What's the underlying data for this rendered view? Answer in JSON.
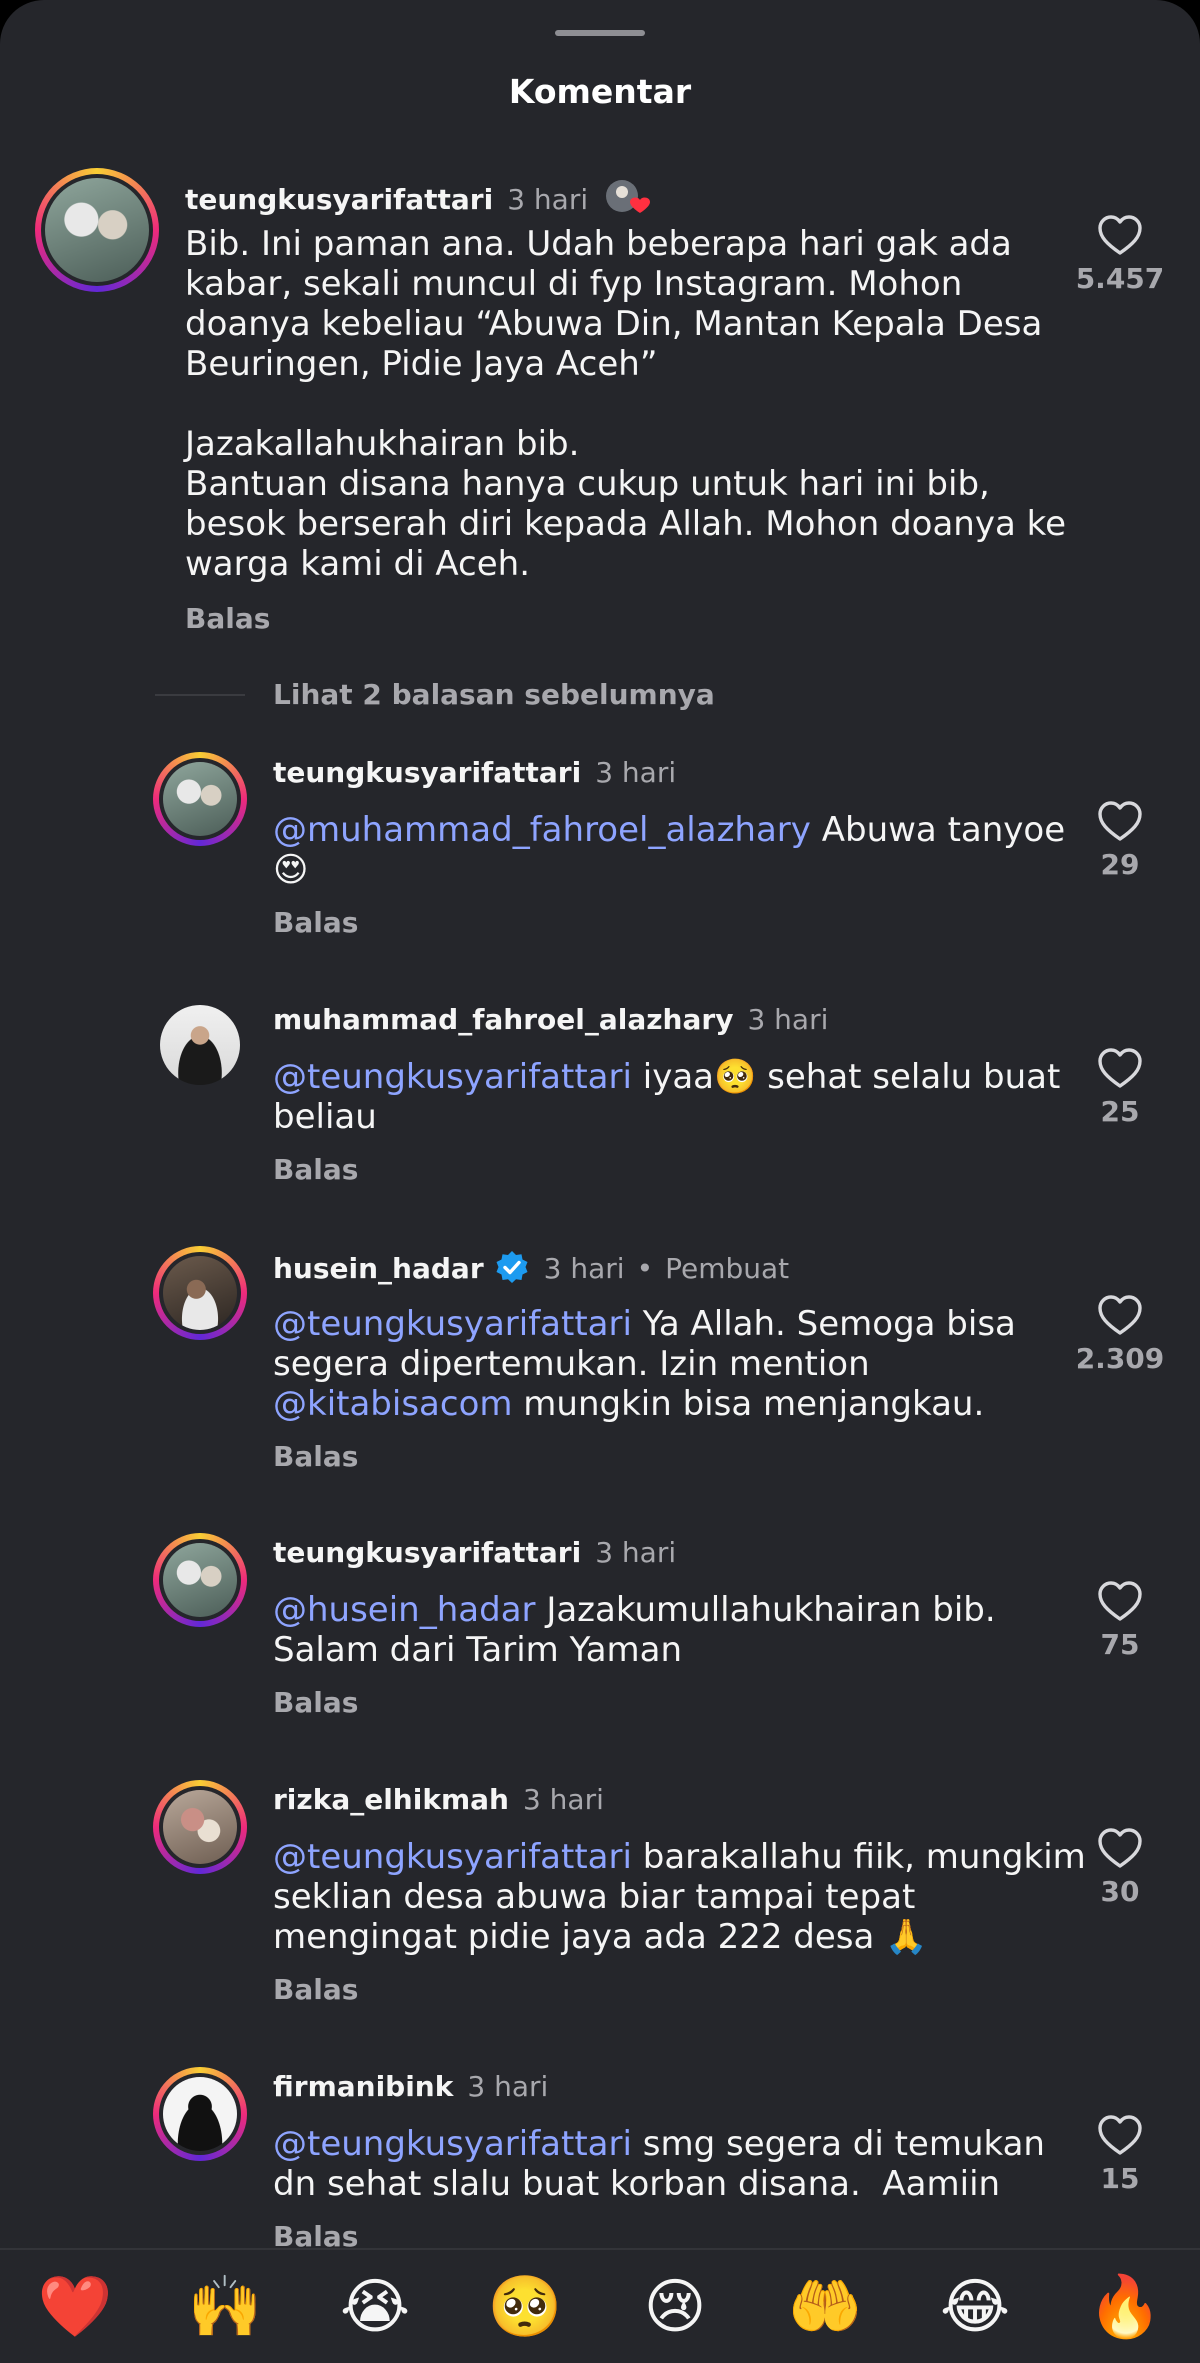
{
  "sheet": {
    "title": "Komentar"
  },
  "thread_toggle": "Lihat 2 balasan sebelumnya",
  "reply_label": "Balas",
  "comments": [
    {
      "username": "teungkusyarifattari",
      "time": "3 hari",
      "text": "Bib. Ini paman ana. Udah beberapa hari gak ada\nkabar, sekali muncul di fyp Instagram. Mohon\ndoanya kebeliau “Abuwa Din, Mantan Kepala Desa\nBeuringen, Pidie Jaya Aceh”\n\nJazakallahukhairan bib.\nBantuan disana hanya cukup untuk hari ini bib,\nbesok berserah diri kepada Allah. Mohon doanya ke\nwarga kami di Aceh.",
      "likes": "5.457"
    },
    {
      "username": "teungkusyarifattari",
      "time": "3 hari",
      "mention": "@muhammad_fahroel_alazhary",
      "text": " Abuwa tanyoe",
      "emoji": "😍",
      "likes": "29"
    },
    {
      "username": "muhammad_fahroel_alazhary",
      "time": "3 hari",
      "mention": "@teungkusyarifattari",
      "text": " iyaa🥺 sehat selalu buat\nbeliau",
      "likes": "25"
    },
    {
      "username": "husein_hadar",
      "time": "3 hari",
      "creator": "Pembuat",
      "mention": "@teungkusyarifattari",
      "text": " Ya Allah. Semoga bisa\nsegera dipertemukan. Izin mention\n",
      "mention2": "@kitabisacom",
      "text2": " mungkin bisa menjangkau.",
      "likes": "2.309"
    },
    {
      "username": "teungkusyarifattari",
      "time": "3 hari",
      "mention": "@husein_hadar",
      "text": " Jazakumullahukhairan bib.\nSalam dari Tarim Yaman",
      "likes": "75"
    },
    {
      "username": "rizka_elhikmah",
      "time": "3 hari",
      "mention": "@teungkusyarifattari",
      "text": " barakallahu fiik, mungkim\nseklian desa abuwa biar tampai tepat\nmengingat pidie jaya ada 222 desa 🙏",
      "likes": "30"
    },
    {
      "username": "firmanibink",
      "time": "3 hari",
      "mention": "@teungkusyarifattari",
      "text": " smg segera di temukan\ndn sehat slalu buat korban disana.  Aamiin",
      "likes": "15"
    }
  ],
  "emoji_bar": [
    "❤️",
    "🙌",
    "😭",
    "🥺",
    "😢",
    "🤲",
    "😂",
    "🔥"
  ],
  "icons": {
    "heart": "heart-outline-icon",
    "verified": "verified-badge-icon"
  },
  "colors": {
    "background": "#25262b",
    "mention": "#8ea4ff",
    "muted": "#a8a8ad",
    "verified": "#1d9bf0"
  }
}
